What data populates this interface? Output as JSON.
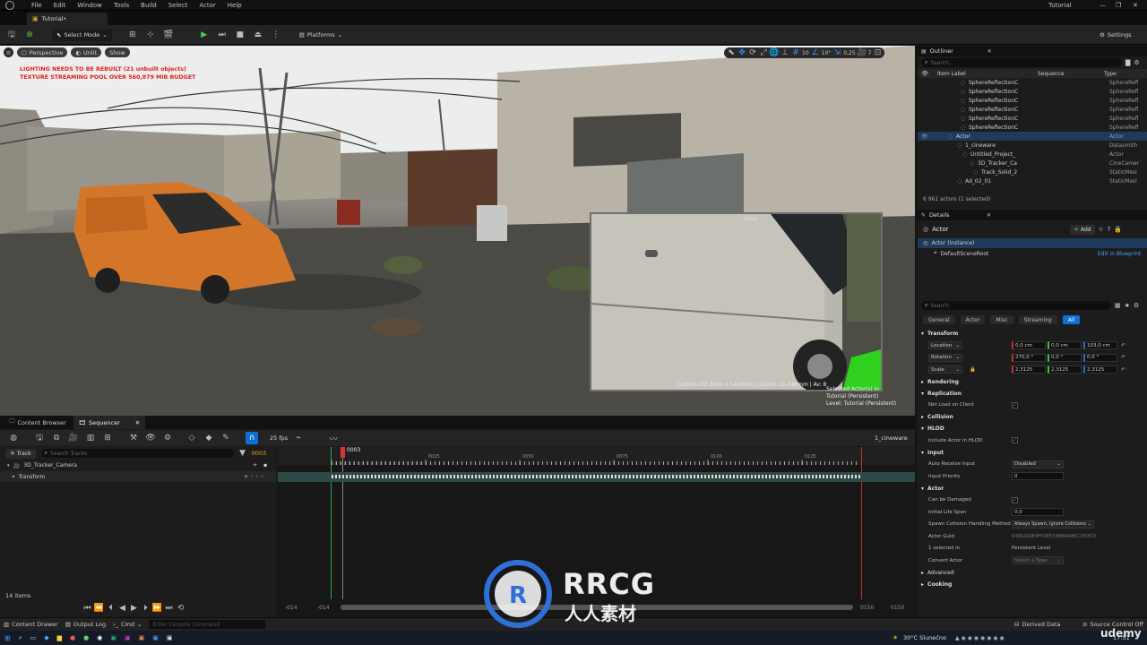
{
  "menu": [
    "File",
    "Edit",
    "Window",
    "Tools",
    "Build",
    "Select",
    "Actor",
    "Help"
  ],
  "project_name": "Tutorial",
  "level_tab": "Tutorial•",
  "toolbar": {
    "select_mode": "Select Mode",
    "platforms": "Platforms",
    "settings": "Settings"
  },
  "viewport": {
    "perspective": "Perspective",
    "lit": "Unlit",
    "show": "Show",
    "warnings": [
      "LIGHTING NEEDS TO BE REBUILT (21 unbuilt objects)",
      "TEXTURE STREAMING POOL OVER 560,879 MiB BUDGET"
    ],
    "suppress_hint": "'DisableAllScreenMessages' to suppress",
    "grid_value": "10",
    "angle_value": "10°",
    "scale_value": "0,25",
    "camera_speed": "7",
    "pip_title": "Actor",
    "pip_info": "Custom (22,3mm x 14,0mm) | Zoom: 11,046mm | Av: 8",
    "selected_info": "Selected Actor(s) in",
    "selected_level": "Tutorial (Persistent)",
    "level_info": "Level: Tutorial (Persistent)"
  },
  "bottom_tabs": {
    "content_browser": "Content Browser",
    "sequencer": "Sequencer"
  },
  "sequencer": {
    "fps": "25 fps",
    "sequence_name": "1_cineware",
    "add_track": "Track",
    "search_placeholder": "Search Tracks",
    "frame": "0003",
    "tracks": [
      "3D_Tracker_Camera",
      "Transform"
    ],
    "ruler_ticks": [
      "0025",
      "0050",
      "0075",
      "0100",
      "0125"
    ],
    "playhead": "0003",
    "items_count": "14 items",
    "range_start": "-014",
    "range_start2": "-014",
    "range_end": "0150",
    "range_end2": "0150"
  },
  "outliner": {
    "title": "Outliner",
    "search_placeholder": "Search...",
    "cols": {
      "label": "Item Label",
      "sequence": "Sequence",
      "type": "Type"
    },
    "rows": [
      {
        "label": "SphereReflectionC",
        "type": "SphereRefl"
      },
      {
        "label": "SphereReflectionC",
        "type": "SphereRefl"
      },
      {
        "label": "SphereReflectionC",
        "type": "SphereRefl"
      },
      {
        "label": "SphereReflectionC",
        "type": "SphereRefl"
      },
      {
        "label": "SphereReflectionC",
        "type": "SphereRefl"
      },
      {
        "label": "SphereReflectionC",
        "type": "SphereRefl"
      },
      {
        "label": "Actor",
        "type": "Actor"
      },
      {
        "label": "1_cineware",
        "type": "Datasmith"
      },
      {
        "label": "Untitled_Project_",
        "type": "Actor"
      },
      {
        "label": "3D_Tracker_Ca",
        "type": "CineCamer"
      },
      {
        "label": "Track_Solid_2",
        "type": "StaticMesl"
      },
      {
        "label": "Ad_02_01",
        "type": "StaticMesl"
      }
    ],
    "count": "6 961 actors (1 selected)"
  },
  "details": {
    "title": "Details",
    "actor_name": "Actor",
    "add_label": "Add",
    "instance": "Actor (Instance)",
    "root": "DefaultSceneRoot",
    "edit_bp": "Edit in Blueprint",
    "search_placeholder": "Search",
    "tabs": [
      "General",
      "Actor",
      "Misc",
      "Streaming",
      "All"
    ],
    "transform_label": "Transform",
    "location_label": "Location",
    "rotation_label": "Rotation",
    "scale_label": "Scale",
    "location": [
      "0,0 cm",
      "0,0 cm",
      "103,0 cm"
    ],
    "rotation": [
      "270,0 °",
      "0,0 °",
      "0,0 °"
    ],
    "scale": [
      "2,3125",
      "2,3125",
      "2,3125"
    ],
    "sections": {
      "rendering": "Rendering",
      "replication": "Replication",
      "net_load": "Net Load on Client",
      "collision": "Collision",
      "hlod": "HLOD",
      "include_hlod": "Include Actor in HLOD",
      "input": "Input",
      "auto_receive": "Auto Receive Input",
      "auto_receive_val": "Disabled",
      "input_priority": "Input Priority",
      "input_priority_val": "0",
      "actor": "Actor",
      "can_damage": "Can be Damaged",
      "life_span": "Initial Life Span",
      "life_span_val": "0,0",
      "spawn": "Spawn Collision Handling Method",
      "spawn_val": "Always Spawn, Ignore Collisions",
      "guid": "Actor Guid",
      "guid_val": "64562D0E4F5DE554BE4498C2303C0",
      "selected_in": "1 selected in",
      "selected_in_val": "Persistent Level",
      "convert": "Convert Actor",
      "convert_val": "Select a Type",
      "advanced": "Advanced",
      "cooking": "Cooking"
    }
  },
  "status": {
    "content_drawer": "Content Drawer",
    "output_log": "Output Log",
    "cmd": "Cmd",
    "console_placeholder": "Enter Console Command",
    "derived": "Derived Data",
    "source": "Source Control Off"
  },
  "taskbar": {
    "weather": "30°C Slunečno",
    "time": "17:51"
  },
  "watermark": {
    "brand": "RRCG",
    "sub": "人人素材",
    "udemy": "udemy"
  }
}
